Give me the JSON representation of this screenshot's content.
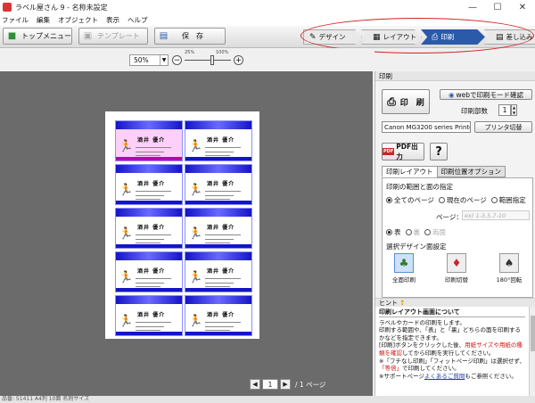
{
  "window": {
    "title": "ラベル屋さん 9 - 名称未設定",
    "minimize": "—",
    "maximize": "☐",
    "close": "✕"
  },
  "menu": [
    "ファイル",
    "編集",
    "オブジェクト",
    "表示",
    "ヘルプ"
  ],
  "toolbar": {
    "top_menu": "トップメニュー",
    "template": "テンプレート",
    "save": "保　存"
  },
  "flow": {
    "design": "デザイン",
    "layout": "レイアウト",
    "print": "印刷",
    "insert": "差し込み"
  },
  "zoom": {
    "value": "50%",
    "tick_min": "25%",
    "tick_max": "100%",
    "level_fraction": 0.6
  },
  "pager": {
    "current": "1",
    "total": "/ 1 ページ",
    "prev": "◀",
    "next": "▶"
  },
  "status": "品番: 51411 A4判 10面 名刺サイズ",
  "panel": {
    "header": "印刷",
    "print_button": "印　刷",
    "web_check": "webで印刷モード確認",
    "copies_label": "印刷部数",
    "copies_value": "1",
    "printer_name": "Canon MG3200 series Printer",
    "printer_switch": "プリンタ切替",
    "pdf_button": "PDF出力",
    "pdf_icon": "PDF",
    "help_button": "?",
    "tabs": [
      "印刷レイアウト",
      "印刷位置オプション"
    ],
    "range_title": "印刷の範囲と面の指定",
    "range_options": [
      "全てのページ",
      "現在のページ",
      "範囲指定"
    ],
    "page_label": "ページ：",
    "page_placeholder": "ex) 1-3,5,7-10",
    "side_options": [
      "表",
      "裏",
      "両面"
    ],
    "design_title": "選択デザイン面設定",
    "design_buttons": [
      "全面印刷",
      "印刷切替",
      "180°回転"
    ]
  },
  "hint": {
    "header": "ヒント",
    "title": "印刷レイアウト画面について",
    "line1": "ラベルやカードの印刷をします。",
    "line2": "印刷する範囲や、「表」と「裏」どちらの面を印刷するかなどを指定できます。",
    "line3a": "[印刷]ボタンをクリックした後、",
    "line3b": "用紙サイズや用紙の種類を確認",
    "line3c": "してから印刷を実行してください。",
    "line4a": "※「フチなし印刷」「フィットページ印刷」は選択せず、",
    "line4b": "「等倍」",
    "line4c": "で印刷してください。",
    "line5a": "※サポートページ",
    "line5b": "よくあるご質問",
    "line5c": "もご参照ください。"
  },
  "card": {
    "name": "酒井 優介"
  },
  "colors": {
    "accent": "#2a5aa8",
    "annotation": "#d62020",
    "card_band": "#1414c8",
    "selected_card": "#fcd0f8"
  }
}
